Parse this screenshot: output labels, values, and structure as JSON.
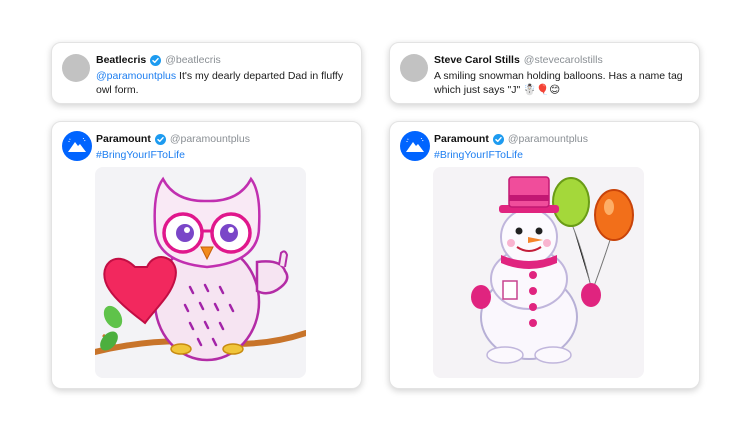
{
  "tweets": [
    {
      "name": "Beatlecris",
      "handle": "@beatlecris",
      "mention": "@paramountplus",
      "text": " It's my dearly departed Dad in fluffy owl form."
    },
    {
      "name": "Steve Carol Stills",
      "handle": "@stevecarolstills",
      "text": "A smiling snowman holding balloons. Has a name tag which just says \"J\" ☃️🎈😊"
    }
  ],
  "replies": [
    {
      "name": "Paramount",
      "handle": "@paramountplus",
      "hashtag": "#BringYourIFToLife",
      "image": "owl-drawing-image"
    },
    {
      "name": "Paramount",
      "handle": "@paramountplus",
      "hashtag": "#BringYourIFToLife",
      "image": "snowman-drawing-image"
    }
  ],
  "colors": {
    "link": "#1d7ef0",
    "verified": "#1d9bf0",
    "brand": "#0064ff"
  },
  "icons": [
    "verified-badge-icon",
    "paramount-logo-icon"
  ]
}
